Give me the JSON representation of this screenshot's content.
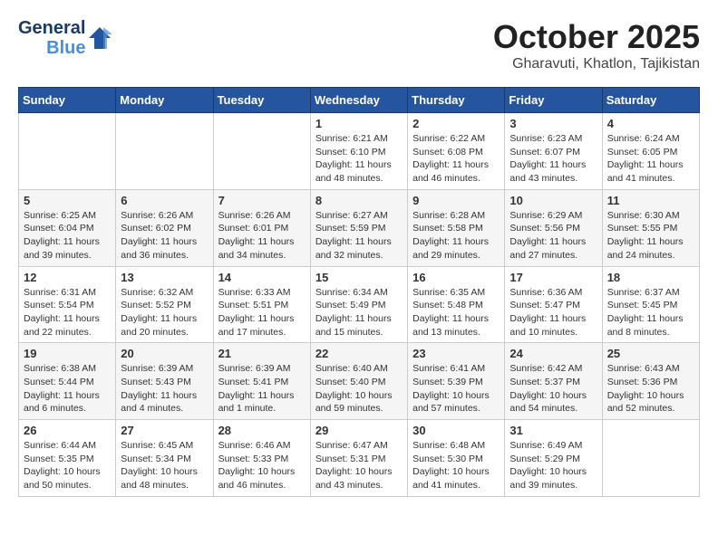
{
  "header": {
    "logo_general": "General",
    "logo_blue": "Blue",
    "month": "October 2025",
    "location": "Gharavuti, Khatlon, Tajikistan"
  },
  "weekdays": [
    "Sunday",
    "Monday",
    "Tuesday",
    "Wednesday",
    "Thursday",
    "Friday",
    "Saturday"
  ],
  "weeks": [
    [
      {
        "day": "",
        "info": ""
      },
      {
        "day": "",
        "info": ""
      },
      {
        "day": "",
        "info": ""
      },
      {
        "day": "1",
        "info": "Sunrise: 6:21 AM\nSunset: 6:10 PM\nDaylight: 11 hours and 48 minutes."
      },
      {
        "day": "2",
        "info": "Sunrise: 6:22 AM\nSunset: 6:08 PM\nDaylight: 11 hours and 46 minutes."
      },
      {
        "day": "3",
        "info": "Sunrise: 6:23 AM\nSunset: 6:07 PM\nDaylight: 11 hours and 43 minutes."
      },
      {
        "day": "4",
        "info": "Sunrise: 6:24 AM\nSunset: 6:05 PM\nDaylight: 11 hours and 41 minutes."
      }
    ],
    [
      {
        "day": "5",
        "info": "Sunrise: 6:25 AM\nSunset: 6:04 PM\nDaylight: 11 hours and 39 minutes."
      },
      {
        "day": "6",
        "info": "Sunrise: 6:26 AM\nSunset: 6:02 PM\nDaylight: 11 hours and 36 minutes."
      },
      {
        "day": "7",
        "info": "Sunrise: 6:26 AM\nSunset: 6:01 PM\nDaylight: 11 hours and 34 minutes."
      },
      {
        "day": "8",
        "info": "Sunrise: 6:27 AM\nSunset: 5:59 PM\nDaylight: 11 hours and 32 minutes."
      },
      {
        "day": "9",
        "info": "Sunrise: 6:28 AM\nSunset: 5:58 PM\nDaylight: 11 hours and 29 minutes."
      },
      {
        "day": "10",
        "info": "Sunrise: 6:29 AM\nSunset: 5:56 PM\nDaylight: 11 hours and 27 minutes."
      },
      {
        "day": "11",
        "info": "Sunrise: 6:30 AM\nSunset: 5:55 PM\nDaylight: 11 hours and 24 minutes."
      }
    ],
    [
      {
        "day": "12",
        "info": "Sunrise: 6:31 AM\nSunset: 5:54 PM\nDaylight: 11 hours and 22 minutes."
      },
      {
        "day": "13",
        "info": "Sunrise: 6:32 AM\nSunset: 5:52 PM\nDaylight: 11 hours and 20 minutes."
      },
      {
        "day": "14",
        "info": "Sunrise: 6:33 AM\nSunset: 5:51 PM\nDaylight: 11 hours and 17 minutes."
      },
      {
        "day": "15",
        "info": "Sunrise: 6:34 AM\nSunset: 5:49 PM\nDaylight: 11 hours and 15 minutes."
      },
      {
        "day": "16",
        "info": "Sunrise: 6:35 AM\nSunset: 5:48 PM\nDaylight: 11 hours and 13 minutes."
      },
      {
        "day": "17",
        "info": "Sunrise: 6:36 AM\nSunset: 5:47 PM\nDaylight: 11 hours and 10 minutes."
      },
      {
        "day": "18",
        "info": "Sunrise: 6:37 AM\nSunset: 5:45 PM\nDaylight: 11 hours and 8 minutes."
      }
    ],
    [
      {
        "day": "19",
        "info": "Sunrise: 6:38 AM\nSunset: 5:44 PM\nDaylight: 11 hours and 6 minutes."
      },
      {
        "day": "20",
        "info": "Sunrise: 6:39 AM\nSunset: 5:43 PM\nDaylight: 11 hours and 4 minutes."
      },
      {
        "day": "21",
        "info": "Sunrise: 6:39 AM\nSunset: 5:41 PM\nDaylight: 11 hours and 1 minute."
      },
      {
        "day": "22",
        "info": "Sunrise: 6:40 AM\nSunset: 5:40 PM\nDaylight: 10 hours and 59 minutes."
      },
      {
        "day": "23",
        "info": "Sunrise: 6:41 AM\nSunset: 5:39 PM\nDaylight: 10 hours and 57 minutes."
      },
      {
        "day": "24",
        "info": "Sunrise: 6:42 AM\nSunset: 5:37 PM\nDaylight: 10 hours and 54 minutes."
      },
      {
        "day": "25",
        "info": "Sunrise: 6:43 AM\nSunset: 5:36 PM\nDaylight: 10 hours and 52 minutes."
      }
    ],
    [
      {
        "day": "26",
        "info": "Sunrise: 6:44 AM\nSunset: 5:35 PM\nDaylight: 10 hours and 50 minutes."
      },
      {
        "day": "27",
        "info": "Sunrise: 6:45 AM\nSunset: 5:34 PM\nDaylight: 10 hours and 48 minutes."
      },
      {
        "day": "28",
        "info": "Sunrise: 6:46 AM\nSunset: 5:33 PM\nDaylight: 10 hours and 46 minutes."
      },
      {
        "day": "29",
        "info": "Sunrise: 6:47 AM\nSunset: 5:31 PM\nDaylight: 10 hours and 43 minutes."
      },
      {
        "day": "30",
        "info": "Sunrise: 6:48 AM\nSunset: 5:30 PM\nDaylight: 10 hours and 41 minutes."
      },
      {
        "day": "31",
        "info": "Sunrise: 6:49 AM\nSunset: 5:29 PM\nDaylight: 10 hours and 39 minutes."
      },
      {
        "day": "",
        "info": ""
      }
    ]
  ]
}
